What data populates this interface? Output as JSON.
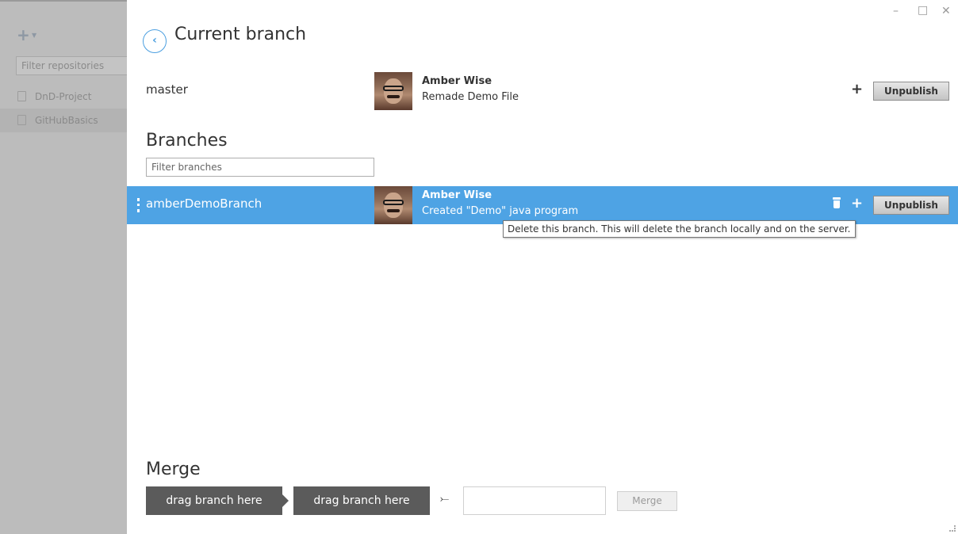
{
  "sidebar": {
    "filter_placeholder": "Filter repositories",
    "repos": [
      {
        "name": "DnD-Project"
      },
      {
        "name": "GitHubBasics"
      }
    ]
  },
  "window_controls": {
    "minimize": "–",
    "maximize": "□",
    "close": "✕"
  },
  "header": {
    "title": "Current branch"
  },
  "current_branch": {
    "name": "master",
    "author": "Amber Wise",
    "commit_message": "Remade Demo File",
    "publish_label": "Unpublish"
  },
  "branches_section": {
    "title": "Branches",
    "filter_placeholder": "Filter branches",
    "items": [
      {
        "name": "amberDemoBranch",
        "author": "Amber Wise",
        "commit_message": "Created \"Demo\" java program",
        "publish_label": "Unpublish",
        "selected": true
      }
    ]
  },
  "tooltip": "Delete this branch. This will delete the branch locally and on the server.",
  "merge": {
    "title": "Merge",
    "source_slot": "drag branch here",
    "target_slot": "drag branch here",
    "merge_button": "Merge"
  },
  "colors": {
    "accent": "#4ea3e4",
    "sidebar_bg": "#bcbcbc",
    "drag_slot": "#5b5b5b"
  },
  "icons": {
    "back": "chevron-left-icon",
    "add": "plus-icon",
    "delete": "trash-icon",
    "merge": "merge-arrow-icon"
  }
}
